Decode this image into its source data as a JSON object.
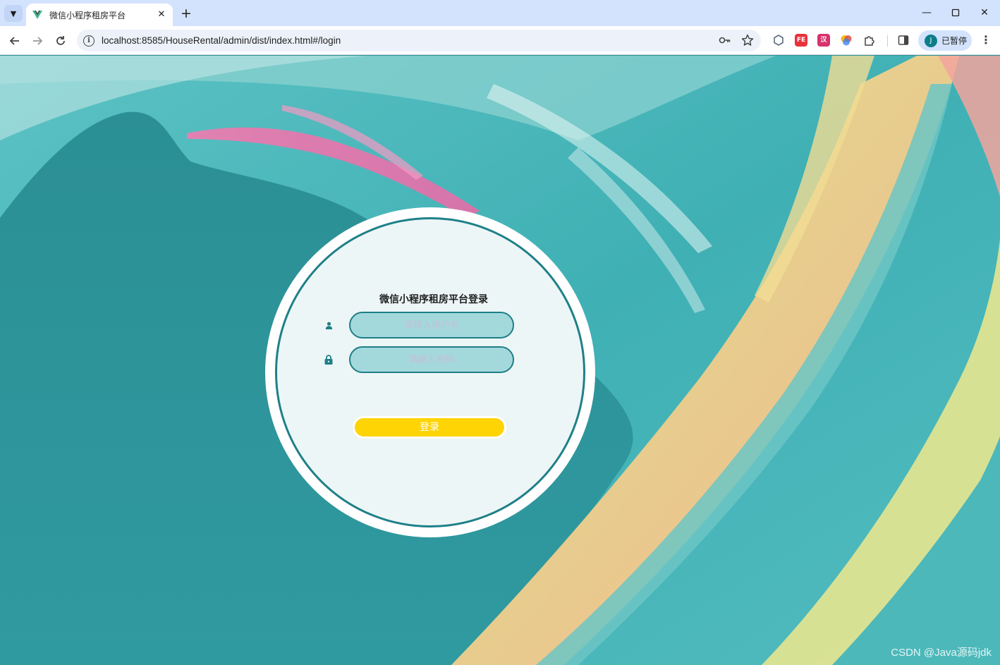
{
  "browser": {
    "tab_title": "微信小程序租房平台",
    "new_tab_symbol": "+",
    "url": "localhost:8585/HouseRental/admin/dist/index.html#/login",
    "profile_initial": "J",
    "profile_label": "已暂停"
  },
  "login": {
    "title": "微信小程序租房平台登录",
    "username_placeholder": "请输入用户名",
    "password_placeholder": "请输入密码",
    "submit_label": "登录"
  },
  "icons": {
    "user": "user-icon",
    "password": "lock-icon"
  },
  "colors": {
    "accent_teal": "#1e8088",
    "button_yellow": "#fed404",
    "input_fill": "#a4d9dc"
  },
  "watermark": "CSDN @Java源码jdk"
}
